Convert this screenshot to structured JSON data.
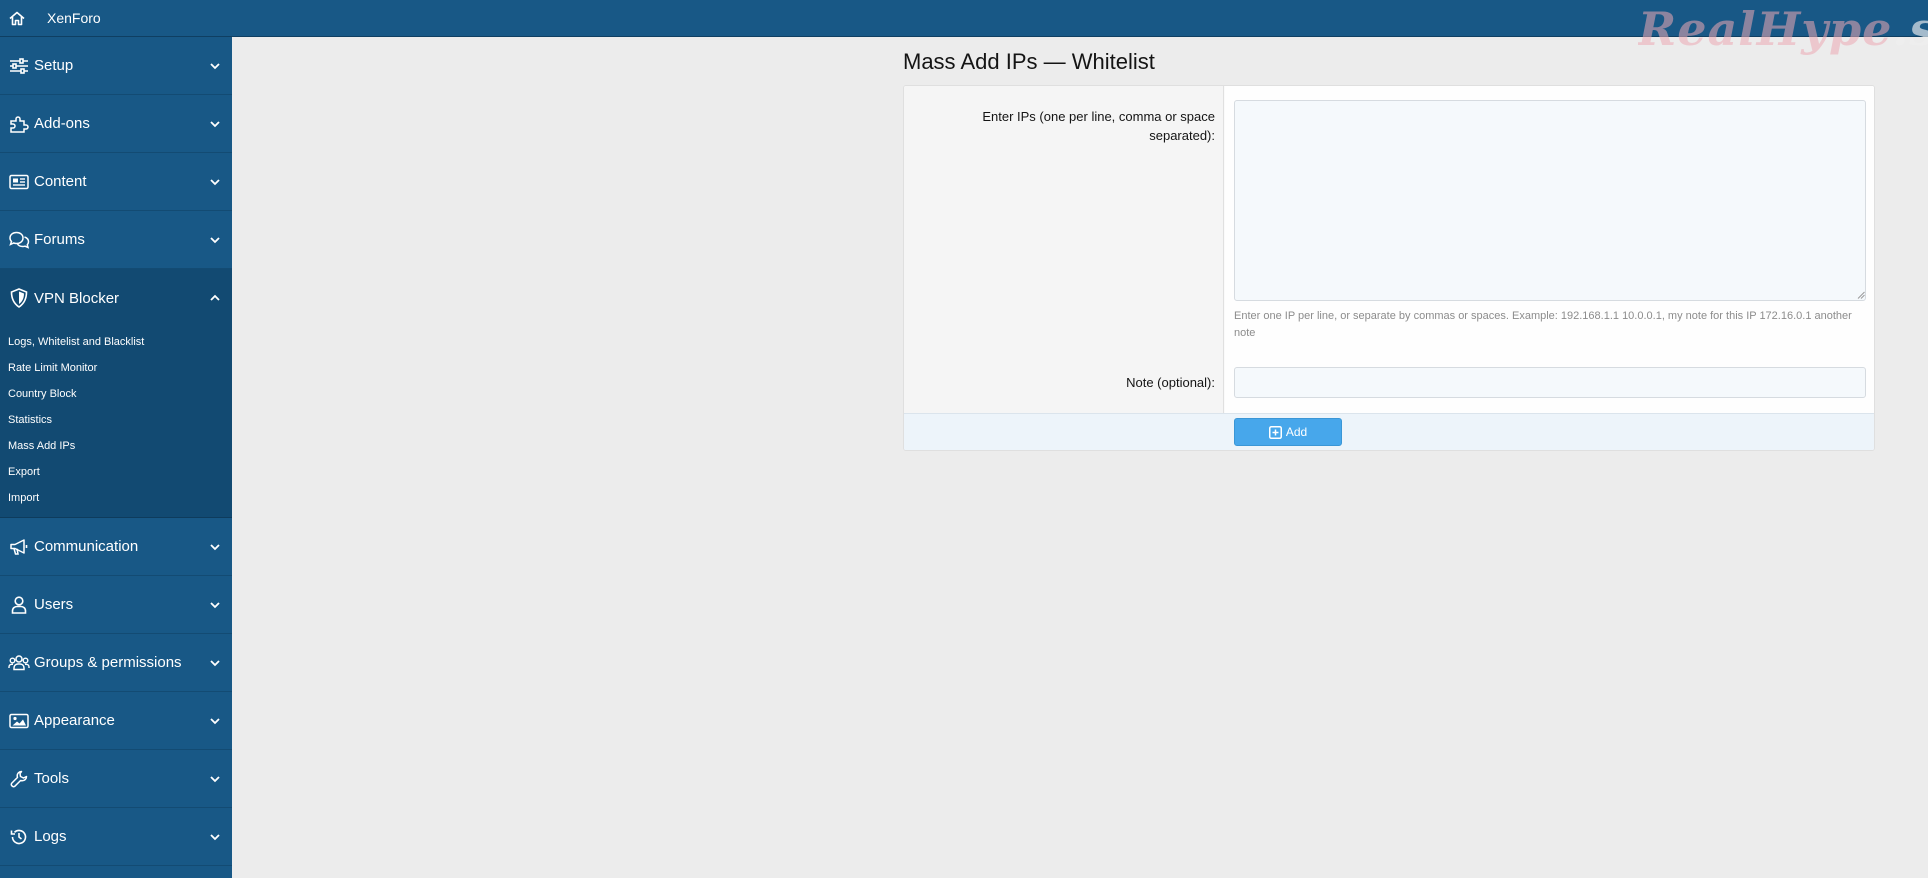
{
  "header": {
    "brand": "XenForo",
    "watermark_main": "RealHype",
    "watermark_tail": ".site"
  },
  "sidebar": {
    "sections": [
      {
        "label": "Setup",
        "icon": "sliders-icon"
      },
      {
        "label": "Add-ons",
        "icon": "puzzle-icon"
      },
      {
        "label": "Content",
        "icon": "newspaper-icon"
      },
      {
        "label": "Forums",
        "icon": "comments-icon"
      },
      {
        "label": "VPN Blocker",
        "icon": "shield-icon",
        "expanded": true
      },
      {
        "label": "Communication",
        "icon": "megaphone-icon"
      },
      {
        "label": "Users",
        "icon": "user-icon"
      },
      {
        "label": "Groups & permissions",
        "icon": "users-icon"
      },
      {
        "label": "Appearance",
        "icon": "image-icon"
      },
      {
        "label": "Tools",
        "icon": "wrench-icon"
      },
      {
        "label": "Logs",
        "icon": "history-icon"
      }
    ],
    "vpn_items": [
      "Logs, Whitelist and Blacklist",
      "Rate Limit Monitor",
      "Country Block",
      "Statistics",
      "Mass Add IPs",
      "Export",
      "Import"
    ]
  },
  "main": {
    "title": "Mass Add IPs — Whitelist",
    "ips_label": "Enter IPs (one per line, comma or space separated):",
    "ips_value": "",
    "hint": "Enter one IP per line, or separate by commas or spaces. Example: 192.168.1.1 10.0.0.1, my note for this IP 172.16.0.1 another note",
    "note_label": "Note (optional):",
    "note_value": "",
    "add_label": "Add"
  },
  "colors": {
    "header_bg": "#185886",
    "sidebar_active_bg": "#124a72",
    "page_bg": "#ececec",
    "button_bg": "#47a7eb"
  }
}
